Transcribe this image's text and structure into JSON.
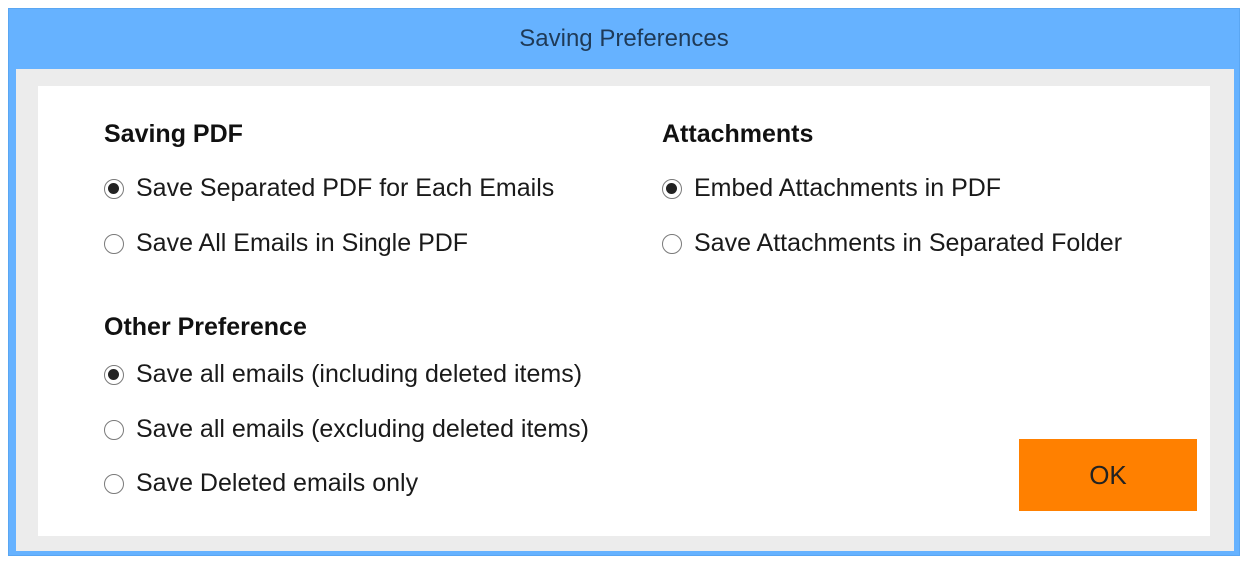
{
  "window": {
    "title": "Saving Preferences"
  },
  "saving_pdf": {
    "title": "Saving PDF",
    "options": [
      {
        "label": "Save Separated PDF for Each Emails",
        "checked": true
      },
      {
        "label": "Save All Emails in Single PDF",
        "checked": false
      }
    ]
  },
  "attachments": {
    "title": "Attachments",
    "options": [
      {
        "label": "Embed Attachments in PDF",
        "checked": true
      },
      {
        "label": "Save Attachments in Separated Folder",
        "checked": false
      }
    ]
  },
  "other_preference": {
    "title": "Other Preference",
    "options": [
      {
        "label": "Save all emails (including deleted items)",
        "checked": true
      },
      {
        "label": "Save all emails (excluding deleted items)",
        "checked": false
      },
      {
        "label": "Save Deleted emails only",
        "checked": false
      }
    ]
  },
  "ok_button": {
    "label": "OK"
  },
  "colors": {
    "titlebar": "#66b2ff",
    "ok_button": "#ff8000",
    "frame": "#ececec"
  }
}
